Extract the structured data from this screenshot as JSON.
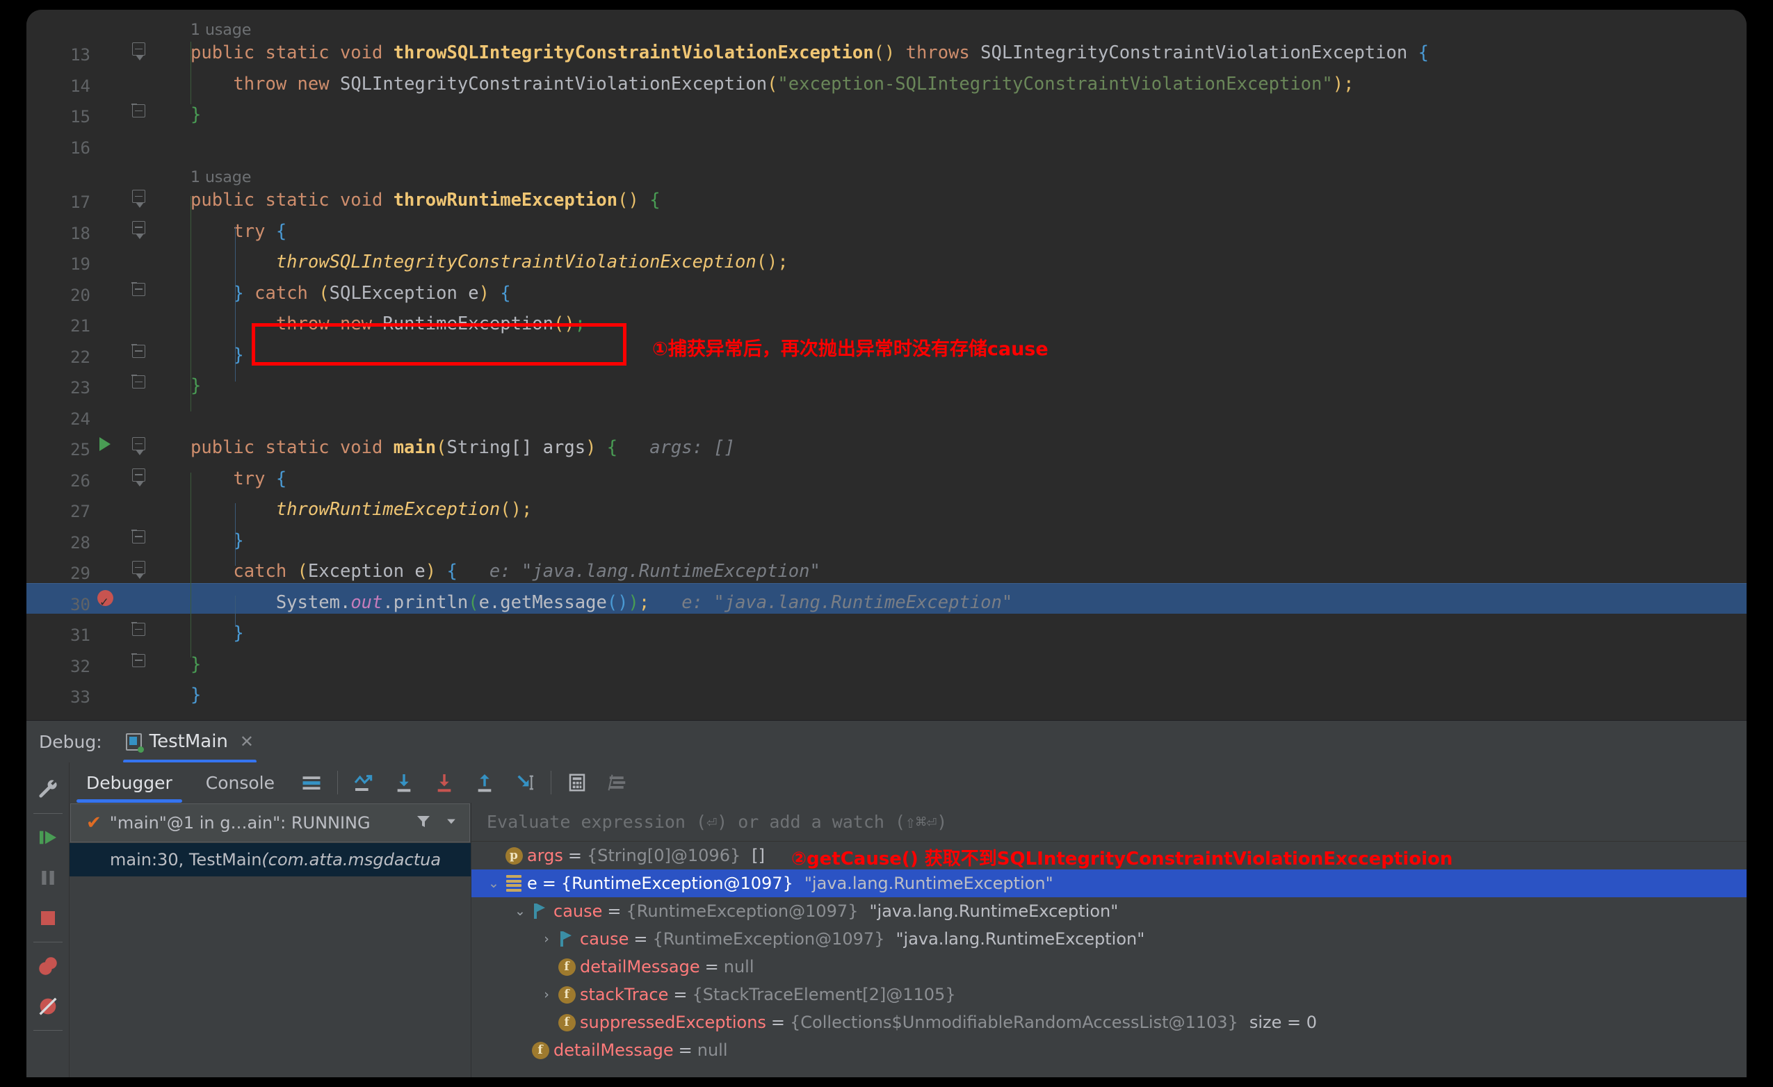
{
  "editor": {
    "lines": [
      {
        "num": "",
        "usage": "1 usage",
        "type": "usage"
      },
      {
        "num": "13",
        "fold": "tri",
        "tokens": [
          {
            "t": "public ",
            "c": "kw"
          },
          {
            "t": "static ",
            "c": "kw"
          },
          {
            "t": "void ",
            "c": "kw"
          },
          {
            "t": "throwSQLIntegrityConstraintViolationException",
            "c": "meth"
          },
          {
            "t": "()",
            "c": "paren"
          },
          {
            "t": " ",
            "c": "plain"
          },
          {
            "t": "throws",
            "c": "kw"
          },
          {
            "t": " SQLIntegrityConstraintViolationException ",
            "c": "type"
          },
          {
            "t": "{",
            "c": "brc-blue"
          }
        ]
      },
      {
        "num": "14",
        "indent": 1,
        "tokens": [
          {
            "t": "    ",
            "c": "plain"
          },
          {
            "t": "throw ",
            "c": "kw"
          },
          {
            "t": "new ",
            "c": "kw"
          },
          {
            "t": "SQLIntegrityConstraintViolationException",
            "c": "type"
          },
          {
            "t": "(",
            "c": "paren"
          },
          {
            "t": "\"exception-SQLIntegrityConstraintViolationException\"",
            "c": "str"
          },
          {
            "t": ")",
            "c": "paren"
          },
          {
            "t": ";",
            "c": "paren"
          }
        ]
      },
      {
        "num": "15",
        "fold": "endbr",
        "tokens": [
          {
            "t": "}",
            "c": "brc-green"
          }
        ]
      },
      {
        "num": "16",
        "tokens": []
      },
      {
        "num": "",
        "usage": "1 usage",
        "type": "usage"
      },
      {
        "num": "17",
        "fold": "tri",
        "tokens": [
          {
            "t": "public ",
            "c": "kw"
          },
          {
            "t": "static ",
            "c": "kw"
          },
          {
            "t": "void ",
            "c": "kw"
          },
          {
            "t": "throwRuntimeException",
            "c": "meth"
          },
          {
            "t": "()",
            "c": "paren"
          },
          {
            "t": " ",
            "c": "plain"
          },
          {
            "t": "{",
            "c": "brc-green"
          }
        ]
      },
      {
        "num": "18",
        "fold": "tri",
        "tokens": [
          {
            "t": "    ",
            "c": "plain"
          },
          {
            "t": "try ",
            "c": "kw"
          },
          {
            "t": "{",
            "c": "brc-blue"
          }
        ]
      },
      {
        "num": "19",
        "tokens": [
          {
            "t": "        ",
            "c": "plain"
          },
          {
            "t": "throwSQLIntegrityConstraintViolationException",
            "c": "methi"
          },
          {
            "t": "()",
            "c": "paren"
          },
          {
            "t": ";",
            "c": "paren"
          }
        ]
      },
      {
        "num": "20",
        "fold": "endbr",
        "tokens": [
          {
            "t": "    ",
            "c": "plain"
          },
          {
            "t": "}",
            "c": "brc-blue"
          },
          {
            "t": " ",
            "c": "plain"
          },
          {
            "t": "catch",
            "c": "kw"
          },
          {
            "t": " ",
            "c": "plain"
          },
          {
            "t": "(",
            "c": "paren"
          },
          {
            "t": "SQLException",
            "c": "type"
          },
          {
            "t": " e",
            "c": "plain"
          },
          {
            "t": ")",
            "c": "paren"
          },
          {
            "t": " ",
            "c": "plain"
          },
          {
            "t": "{",
            "c": "brc-blue"
          }
        ]
      },
      {
        "num": "21",
        "tokens": [
          {
            "t": "        ",
            "c": "plain"
          },
          {
            "t": "throw ",
            "c": "kw"
          },
          {
            "t": "new ",
            "c": "kw"
          },
          {
            "t": "RuntimeException",
            "c": "type"
          },
          {
            "t": "()",
            "c": "paren"
          },
          {
            "t": ";",
            "c": "brc-green"
          }
        ]
      },
      {
        "num": "22",
        "fold": "endbr",
        "tokens": [
          {
            "t": "    ",
            "c": "plain"
          },
          {
            "t": "}",
            "c": "brc-blue"
          }
        ]
      },
      {
        "num": "23",
        "fold": "endbr",
        "tokens": [
          {
            "t": "}",
            "c": "brc-green"
          }
        ]
      },
      {
        "num": "24",
        "tokens": []
      },
      {
        "num": "25",
        "fold": "tri",
        "runmark": true,
        "tokens": [
          {
            "t": "public ",
            "c": "kw"
          },
          {
            "t": "static ",
            "c": "kw"
          },
          {
            "t": "void ",
            "c": "kw"
          },
          {
            "t": "main",
            "c": "meth"
          },
          {
            "t": "(",
            "c": "paren"
          },
          {
            "t": "String",
            "c": "type"
          },
          {
            "t": "[] args",
            "c": "plain"
          },
          {
            "t": ")",
            "c": "paren"
          },
          {
            "t": " ",
            "c": "plain"
          },
          {
            "t": "{",
            "c": "brc-green"
          },
          {
            "t": "   args: []",
            "c": "hint"
          }
        ]
      },
      {
        "num": "26",
        "fold": "tri",
        "tokens": [
          {
            "t": "    ",
            "c": "plain"
          },
          {
            "t": "try ",
            "c": "kw"
          },
          {
            "t": "{",
            "c": "brc-blue"
          }
        ]
      },
      {
        "num": "27",
        "tokens": [
          {
            "t": "        ",
            "c": "plain"
          },
          {
            "t": "throwRuntimeException",
            "c": "methi"
          },
          {
            "t": "()",
            "c": "paren"
          },
          {
            "t": ";",
            "c": "paren"
          }
        ]
      },
      {
        "num": "28",
        "fold": "endbr",
        "tokens": [
          {
            "t": "    ",
            "c": "plain"
          },
          {
            "t": "}",
            "c": "brc-blue"
          }
        ]
      },
      {
        "num": "29",
        "fold": "tri",
        "tokens": [
          {
            "t": "    ",
            "c": "plain"
          },
          {
            "t": "catch",
            "c": "kw"
          },
          {
            "t": " ",
            "c": "plain"
          },
          {
            "t": "(",
            "c": "paren"
          },
          {
            "t": "Exception",
            "c": "type"
          },
          {
            "t": " e",
            "c": "plain"
          },
          {
            "t": ")",
            "c": "paren"
          },
          {
            "t": " ",
            "c": "plain"
          },
          {
            "t": "{",
            "c": "brc-blue"
          },
          {
            "t": "   e: \"java.lang.RuntimeException\"",
            "c": "hint"
          }
        ]
      },
      {
        "num": "30",
        "breakpoint": true,
        "highlight": true,
        "tokens": [
          {
            "t": "        ",
            "c": "plain"
          },
          {
            "t": "System",
            "c": "plain"
          },
          {
            "t": ".",
            "c": "plain"
          },
          {
            "t": "out",
            "c": "field"
          },
          {
            "t": ".",
            "c": "plain"
          },
          {
            "t": "println",
            "c": "plain"
          },
          {
            "t": "(",
            "c": "brc-green"
          },
          {
            "t": "e",
            "c": "plain"
          },
          {
            "t": ".",
            "c": "plain"
          },
          {
            "t": "getMessage",
            "c": "plain"
          },
          {
            "t": "()",
            "c": "brc-blue"
          },
          {
            "t": ")",
            "c": "brc-green"
          },
          {
            "t": ";",
            "c": "paren"
          },
          {
            "t": "   e: \"java.lang.RuntimeException\"",
            "c": "hint"
          }
        ]
      },
      {
        "num": "31",
        "fold": "endbr",
        "tokens": [
          {
            "t": "    ",
            "c": "plain"
          },
          {
            "t": "}",
            "c": "brc-blue"
          }
        ]
      },
      {
        "num": "32",
        "fold": "endbr",
        "tokens": [
          {
            "t": "",
            "c": "plain"
          },
          {
            "t": "}",
            "c": "brc-green"
          }
        ]
      },
      {
        "num": "33",
        "tokens": [
          {
            "t": "}",
            "c": "brc-blue"
          }
        ]
      }
    ],
    "annotation_1": "①捕获异常后，再次抛出异常时没有存储cause"
  },
  "debug_header": {
    "label": "Debug:",
    "config_name": "TestMain",
    "close_label": "✕"
  },
  "debug_toolbar": {
    "tabs": [
      {
        "label": "Debugger",
        "active": true
      },
      {
        "label": "Console",
        "active": false
      }
    ],
    "icons": [
      "layout-icon",
      "show-execution-point-icon",
      "step-over-icon",
      "step-into-icon",
      "force-step-into-icon",
      "step-out-icon",
      "run-to-cursor-icon",
      "evaluate-expression-icon",
      "settings-lines-icon"
    ]
  },
  "side_rail": {
    "icons": [
      "wrench-settings-icon",
      "resume-program-icon",
      "pause-program-icon",
      "stop-program-icon",
      "view-breakpoints-icon",
      "mute-breakpoints-icon"
    ]
  },
  "frames": {
    "thread_label": "\"main\"@1 in g…ain\": RUNNING",
    "thread_status_icon": "check-icon",
    "filter_icon": "filter-icon",
    "dropdown_icon": "chevron-down-icon",
    "items": [
      {
        "text": "main:30, TestMain ",
        "italic": "(com.atta.msgdactua",
        "selected": true
      }
    ]
  },
  "evaluate": {
    "placeholder": "Evaluate expression (⏎) or add a watch (⇧⌘⏎)"
  },
  "variables": {
    "annotation_2": "②getCause() 获取不到SQLIntegrityConstraintViolationExcceptioion",
    "rows": [
      {
        "indent": 0,
        "chev": "",
        "icon": "param",
        "name": "args",
        "eq": "=",
        "value": "{String[0]@1096}",
        "extra": "[]",
        "selected": false
      },
      {
        "indent": 0,
        "chev": "down",
        "icon": "obj",
        "name": "e",
        "eq": "=",
        "value": "{RuntimeException@1097}",
        "extra": "\"java.lang.RuntimeException\"",
        "selected": true
      },
      {
        "indent": 1,
        "chev": "down",
        "icon": "flag",
        "name": "cause",
        "eq": "=",
        "value": "{RuntimeException@1097}",
        "extra": "\"java.lang.RuntimeException\"",
        "selected": false
      },
      {
        "indent": 2,
        "chev": "right",
        "icon": "flag",
        "name": "cause",
        "eq": "=",
        "value": "{RuntimeException@1097}",
        "extra": "\"java.lang.RuntimeException\"",
        "selected": false
      },
      {
        "indent": 2,
        "chev": "",
        "icon": "field",
        "name": "detailMessage",
        "eq": "=",
        "value": "null",
        "extra": "",
        "selected": false
      },
      {
        "indent": 2,
        "chev": "right",
        "icon": "field",
        "name": "stackTrace",
        "eq": "=",
        "value": "{StackTraceElement[2]@1105}",
        "extra": "",
        "selected": false
      },
      {
        "indent": 2,
        "chev": "",
        "icon": "field",
        "name": "suppressedExceptions",
        "eq": "=",
        "value": "{Collections$UnmodifiableRandomAccessList@1103}",
        "extra": "size = 0",
        "selected": false
      },
      {
        "indent": 1,
        "chev": "",
        "icon": "field",
        "name": "detailMessage",
        "eq": "=",
        "value": "null",
        "extra": "",
        "selected": false
      }
    ]
  },
  "colors": {
    "editor_bg": "#2b2b2b",
    "panel_bg": "#3c3f41",
    "selection_blue": "#2b53c4",
    "highlight_line": "#2d4f7c",
    "accent_blue": "#3574f0",
    "annotation_red": "#ff0000",
    "frame_selected": "#0d2436"
  }
}
